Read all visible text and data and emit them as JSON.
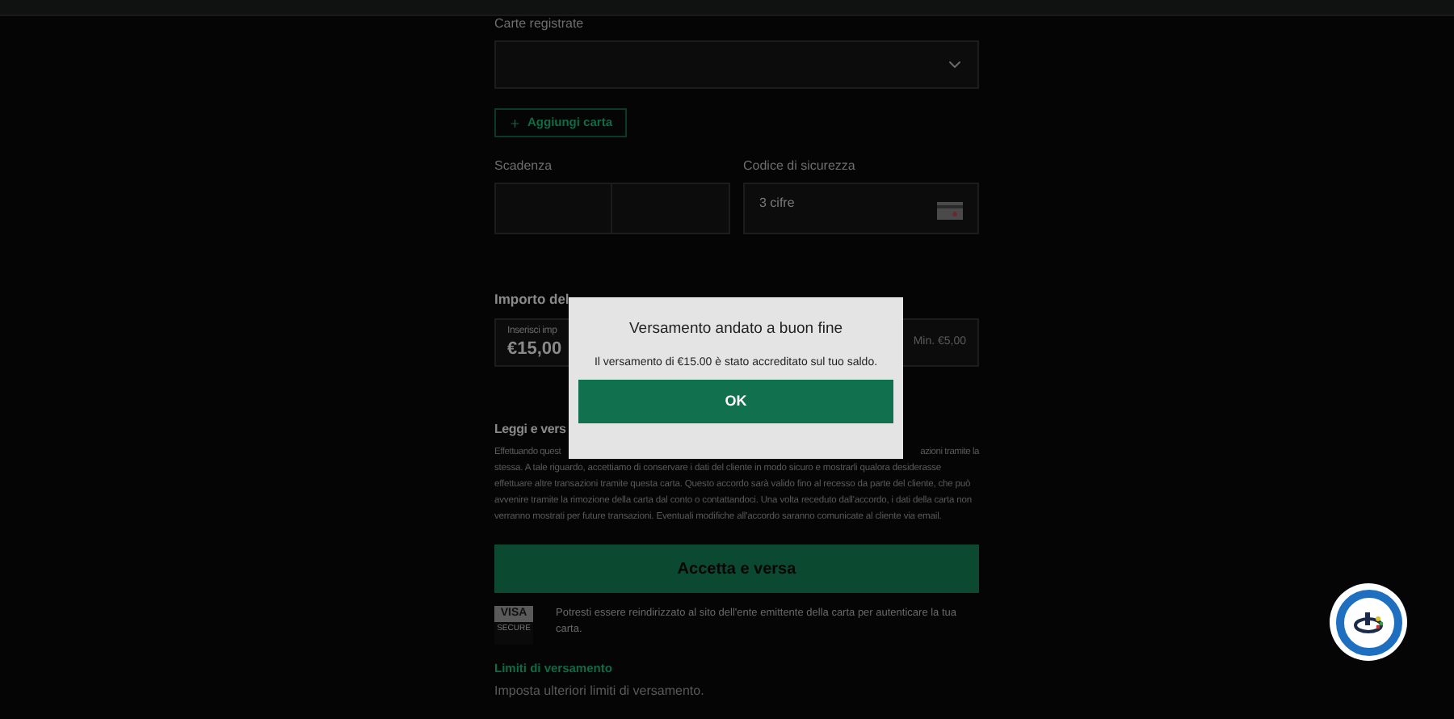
{
  "form": {
    "saved_cards": {
      "label": "Carte registrate"
    },
    "add_card_button": "Aggiungi carta",
    "expiry": {
      "label": "Scadenza"
    },
    "security_code": {
      "label": "Codice di sicurezza",
      "placeholder": "3 cifre"
    },
    "amount_heading": "Importo del",
    "amount": {
      "label": "Inserisci imp",
      "value": "€15,00",
      "hint": "Min. €5,00"
    },
    "terms_heading": "Leggi e vers",
    "terms_first_line": [
      "Effettuando quest",
      "azioni tramite la"
    ],
    "terms_rest": "stessa. A tale riguardo, accettiamo di conservare i dati del cliente in modo sicuro e mostrarli qualora desiderasse effettuare altre transazioni tramite questa carta. Questo accordo sarà valido fino al recesso da parte del cliente, che può avvenire tramite la rimozione della carta dal conto o contattandoci. Una volta receduto dall'accordo, i dati della carta non verranno mostrati per future transazioni. Eventuali modifiche all'accordo saranno comunicate al cliente via email.",
    "submit_button": "Accetta e versa",
    "visa_badge": {
      "brand": "VISA",
      "sub": "SECURE"
    },
    "redirect_note": "Potresti essere reindirizzato al sito dell'ente emittente della carta per autenticare la tua carta.",
    "limits_link": "Limiti di versamento",
    "limits_text": "Imposta ulteriori limiti di versamento."
  },
  "dialog": {
    "title": "Versamento andato a buon fine",
    "message": "Il versamento di €15.00 è stato accreditato sul tuo saldo.",
    "button": "OK"
  }
}
